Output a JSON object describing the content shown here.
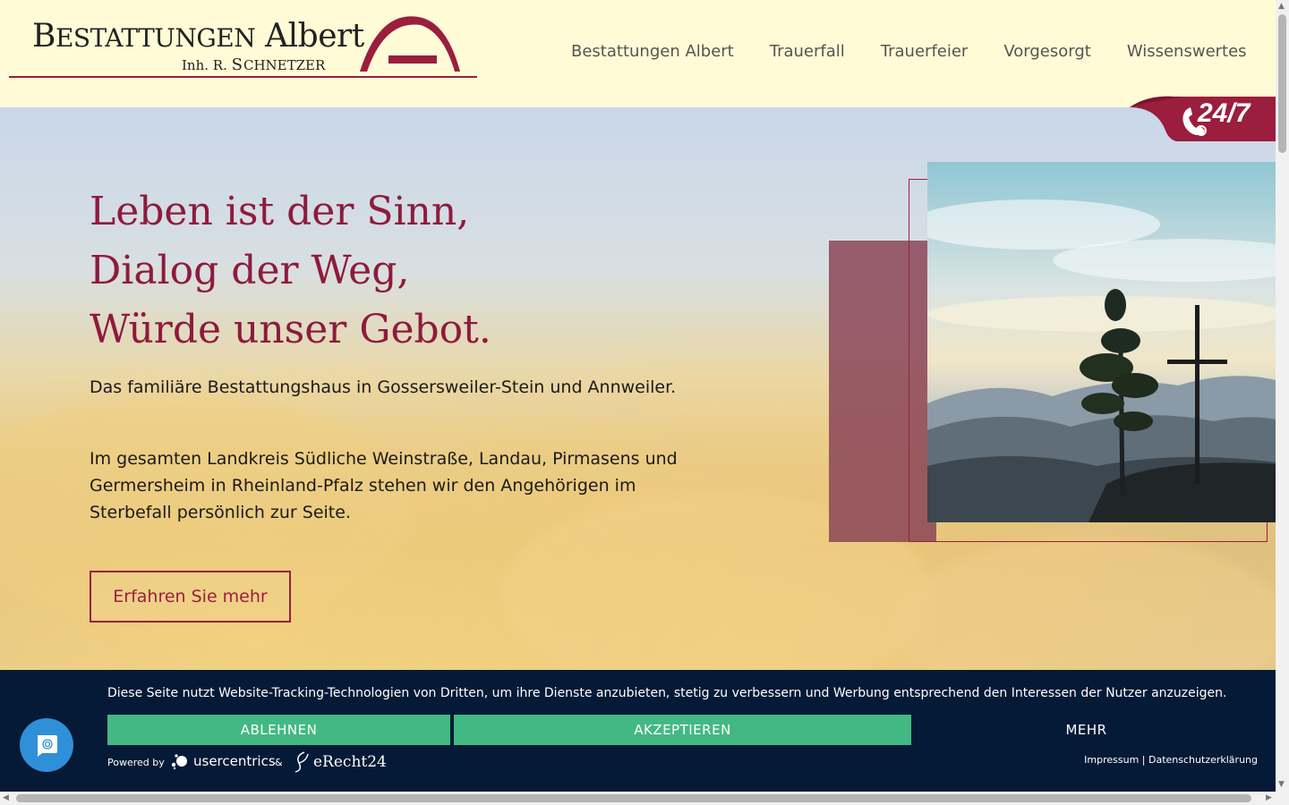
{
  "header": {
    "logo": {
      "line1_cap_b": "B",
      "line1_rest": "ESTATTUNGEN",
      "line1_name": "Albert",
      "line2_inh": "Inh. R.",
      "line2_cap_s": "S",
      "line2_rest": "CHNETZER"
    },
    "nav": [
      "Bestattungen Albert",
      "Trauerfall",
      "Trauerfeier",
      "Vorgesorgt",
      "Wissenswertes"
    ]
  },
  "badge": {
    "text": "24/7"
  },
  "hero": {
    "headline": [
      "Leben ist der Sinn,",
      "Dialog der Weg,",
      "Würde unser Gebot."
    ],
    "p1": "Das familiäre Bestattungshaus in Gossersweiler-Stein und Annweiler.",
    "p2": "Im gesamten Landkreis Südliche Weinstraße, Landau, Pirmasens und Germersheim in Rheinland-Pfalz stehen wir den Angehörigen im Sterbefall persönlich zur Seite.",
    "cta": "Erfahren Sie mehr"
  },
  "cookie": {
    "text": "Diese Seite nutzt Website-Tracking-Technologien von Dritten, um ihre Dienste anzubieten, stetig zu verbessern und Werbung entsprechend den Interessen der Nutzer anzuzeigen.",
    "decline": "ABLEHNEN",
    "accept": "AKZEPTIEREN",
    "more": "MEHR",
    "powered_by": "Powered by",
    "usercentrics": "usercentrics",
    "amp": "&",
    "erecht": "eRecht24",
    "impressum": "Impressum",
    "separator": "|",
    "datenschutz": "Datenschutzerklärung"
  },
  "colors": {
    "accent": "#9b1e3e",
    "header_bg": "#fffbd6",
    "cookie_bg": "#051a36",
    "button_green": "#43b883",
    "chat_blue": "#2f8fd8"
  }
}
